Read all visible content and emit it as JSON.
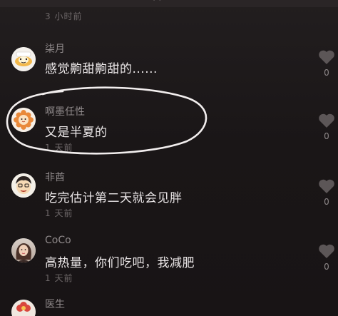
{
  "header": {
    "time": "3 小时前"
  },
  "comments": [
    {
      "name": "柒月",
      "text": "感觉齁甜齁甜的......",
      "time": "",
      "likes": "0",
      "avatar": "egg-cartoon-avatar"
    },
    {
      "name": "啊墨任性",
      "text": "又是半夏的",
      "time": "1 天前",
      "likes": "0",
      "avatar": "flower-avatar"
    },
    {
      "name": "非酋",
      "text": "吃完估计第二天就会见胖",
      "time": "1 天前",
      "likes": "0",
      "avatar": "cartoon-face-avatar"
    },
    {
      "name": "CoCo",
      "text": "高热量，你们吃吧，我减肥",
      "time": "1 天前",
      "likes": "0",
      "avatar": "photo-avatar"
    },
    {
      "name": "医生",
      "text": "",
      "time": "",
      "likes": "",
      "avatar": "flower-avatar"
    }
  ],
  "colors": {
    "background": "#1b1718",
    "username": "#8e8889",
    "comment_text": "#ebe7e8",
    "timestamp": "#6d6768",
    "heart": "#5c5657",
    "annotation_circle": "#f2eeee"
  },
  "icons": {
    "like": "heart-icon"
  }
}
